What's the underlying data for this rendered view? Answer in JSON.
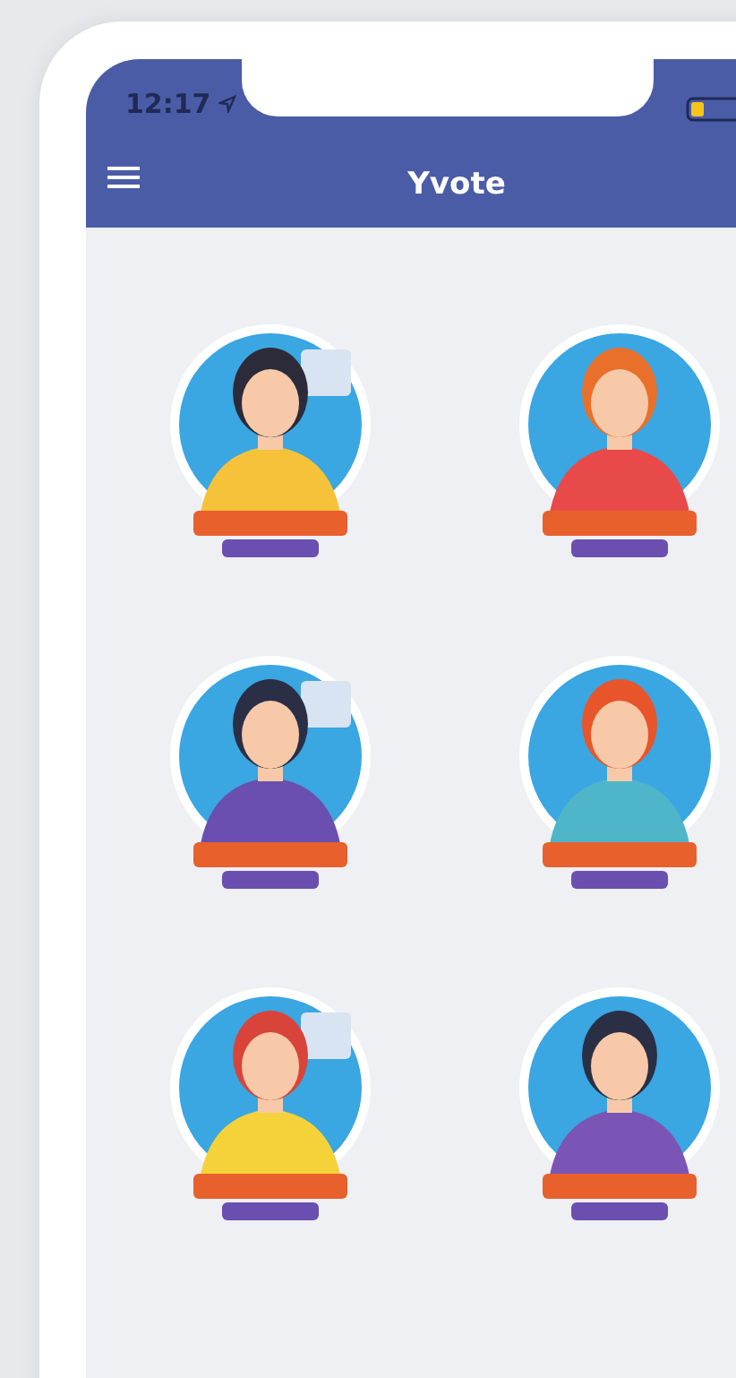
{
  "status_bar": {
    "time": "12:17"
  },
  "app_bar": {
    "title": "Yvote"
  }
}
